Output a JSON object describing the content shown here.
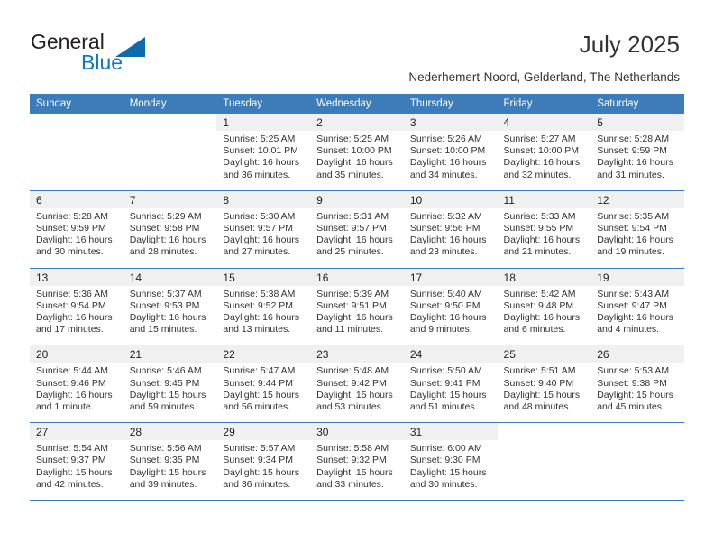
{
  "brand": {
    "name_part1": "General",
    "name_part2": "Blue"
  },
  "header": {
    "title": "July 2025",
    "subtitle": "Nederhemert-Noord, Gelderland, The Netherlands"
  },
  "colors": {
    "header_blue": "#3d7cb8",
    "daynum_band": "#f0f0f0",
    "brand_blue": "#1278be",
    "text": "#333333"
  },
  "calendar": {
    "weekday_headers": [
      "Sunday",
      "Monday",
      "Tuesday",
      "Wednesday",
      "Thursday",
      "Friday",
      "Saturday"
    ],
    "weeks": [
      [
        {
          "day": "",
          "lines": []
        },
        {
          "day": "",
          "lines": []
        },
        {
          "day": "1",
          "lines": [
            "Sunrise: 5:25 AM",
            "Sunset: 10:01 PM",
            "Daylight: 16 hours",
            "and 36 minutes."
          ]
        },
        {
          "day": "2",
          "lines": [
            "Sunrise: 5:25 AM",
            "Sunset: 10:00 PM",
            "Daylight: 16 hours",
            "and 35 minutes."
          ]
        },
        {
          "day": "3",
          "lines": [
            "Sunrise: 5:26 AM",
            "Sunset: 10:00 PM",
            "Daylight: 16 hours",
            "and 34 minutes."
          ]
        },
        {
          "day": "4",
          "lines": [
            "Sunrise: 5:27 AM",
            "Sunset: 10:00 PM",
            "Daylight: 16 hours",
            "and 32 minutes."
          ]
        },
        {
          "day": "5",
          "lines": [
            "Sunrise: 5:28 AM",
            "Sunset: 9:59 PM",
            "Daylight: 16 hours",
            "and 31 minutes."
          ]
        }
      ],
      [
        {
          "day": "6",
          "lines": [
            "Sunrise: 5:28 AM",
            "Sunset: 9:59 PM",
            "Daylight: 16 hours",
            "and 30 minutes."
          ]
        },
        {
          "day": "7",
          "lines": [
            "Sunrise: 5:29 AM",
            "Sunset: 9:58 PM",
            "Daylight: 16 hours",
            "and 28 minutes."
          ]
        },
        {
          "day": "8",
          "lines": [
            "Sunrise: 5:30 AM",
            "Sunset: 9:57 PM",
            "Daylight: 16 hours",
            "and 27 minutes."
          ]
        },
        {
          "day": "9",
          "lines": [
            "Sunrise: 5:31 AM",
            "Sunset: 9:57 PM",
            "Daylight: 16 hours",
            "and 25 minutes."
          ]
        },
        {
          "day": "10",
          "lines": [
            "Sunrise: 5:32 AM",
            "Sunset: 9:56 PM",
            "Daylight: 16 hours",
            "and 23 minutes."
          ]
        },
        {
          "day": "11",
          "lines": [
            "Sunrise: 5:33 AM",
            "Sunset: 9:55 PM",
            "Daylight: 16 hours",
            "and 21 minutes."
          ]
        },
        {
          "day": "12",
          "lines": [
            "Sunrise: 5:35 AM",
            "Sunset: 9:54 PM",
            "Daylight: 16 hours",
            "and 19 minutes."
          ]
        }
      ],
      [
        {
          "day": "13",
          "lines": [
            "Sunrise: 5:36 AM",
            "Sunset: 9:54 PM",
            "Daylight: 16 hours",
            "and 17 minutes."
          ]
        },
        {
          "day": "14",
          "lines": [
            "Sunrise: 5:37 AM",
            "Sunset: 9:53 PM",
            "Daylight: 16 hours",
            "and 15 minutes."
          ]
        },
        {
          "day": "15",
          "lines": [
            "Sunrise: 5:38 AM",
            "Sunset: 9:52 PM",
            "Daylight: 16 hours",
            "and 13 minutes."
          ]
        },
        {
          "day": "16",
          "lines": [
            "Sunrise: 5:39 AM",
            "Sunset: 9:51 PM",
            "Daylight: 16 hours",
            "and 11 minutes."
          ]
        },
        {
          "day": "17",
          "lines": [
            "Sunrise: 5:40 AM",
            "Sunset: 9:50 PM",
            "Daylight: 16 hours",
            "and 9 minutes."
          ]
        },
        {
          "day": "18",
          "lines": [
            "Sunrise: 5:42 AM",
            "Sunset: 9:48 PM",
            "Daylight: 16 hours",
            "and 6 minutes."
          ]
        },
        {
          "day": "19",
          "lines": [
            "Sunrise: 5:43 AM",
            "Sunset: 9:47 PM",
            "Daylight: 16 hours",
            "and 4 minutes."
          ]
        }
      ],
      [
        {
          "day": "20",
          "lines": [
            "Sunrise: 5:44 AM",
            "Sunset: 9:46 PM",
            "Daylight: 16 hours",
            "and 1 minute."
          ]
        },
        {
          "day": "21",
          "lines": [
            "Sunrise: 5:46 AM",
            "Sunset: 9:45 PM",
            "Daylight: 15 hours",
            "and 59 minutes."
          ]
        },
        {
          "day": "22",
          "lines": [
            "Sunrise: 5:47 AM",
            "Sunset: 9:44 PM",
            "Daylight: 15 hours",
            "and 56 minutes."
          ]
        },
        {
          "day": "23",
          "lines": [
            "Sunrise: 5:48 AM",
            "Sunset: 9:42 PM",
            "Daylight: 15 hours",
            "and 53 minutes."
          ]
        },
        {
          "day": "24",
          "lines": [
            "Sunrise: 5:50 AM",
            "Sunset: 9:41 PM",
            "Daylight: 15 hours",
            "and 51 minutes."
          ]
        },
        {
          "day": "25",
          "lines": [
            "Sunrise: 5:51 AM",
            "Sunset: 9:40 PM",
            "Daylight: 15 hours",
            "and 48 minutes."
          ]
        },
        {
          "day": "26",
          "lines": [
            "Sunrise: 5:53 AM",
            "Sunset: 9:38 PM",
            "Daylight: 15 hours",
            "and 45 minutes."
          ]
        }
      ],
      [
        {
          "day": "27",
          "lines": [
            "Sunrise: 5:54 AM",
            "Sunset: 9:37 PM",
            "Daylight: 15 hours",
            "and 42 minutes."
          ]
        },
        {
          "day": "28",
          "lines": [
            "Sunrise: 5:56 AM",
            "Sunset: 9:35 PM",
            "Daylight: 15 hours",
            "and 39 minutes."
          ]
        },
        {
          "day": "29",
          "lines": [
            "Sunrise: 5:57 AM",
            "Sunset: 9:34 PM",
            "Daylight: 15 hours",
            "and 36 minutes."
          ]
        },
        {
          "day": "30",
          "lines": [
            "Sunrise: 5:58 AM",
            "Sunset: 9:32 PM",
            "Daylight: 15 hours",
            "and 33 minutes."
          ]
        },
        {
          "day": "31",
          "lines": [
            "Sunrise: 6:00 AM",
            "Sunset: 9:30 PM",
            "Daylight: 15 hours",
            "and 30 minutes."
          ]
        },
        {
          "day": "",
          "lines": []
        },
        {
          "day": "",
          "lines": []
        }
      ]
    ]
  }
}
